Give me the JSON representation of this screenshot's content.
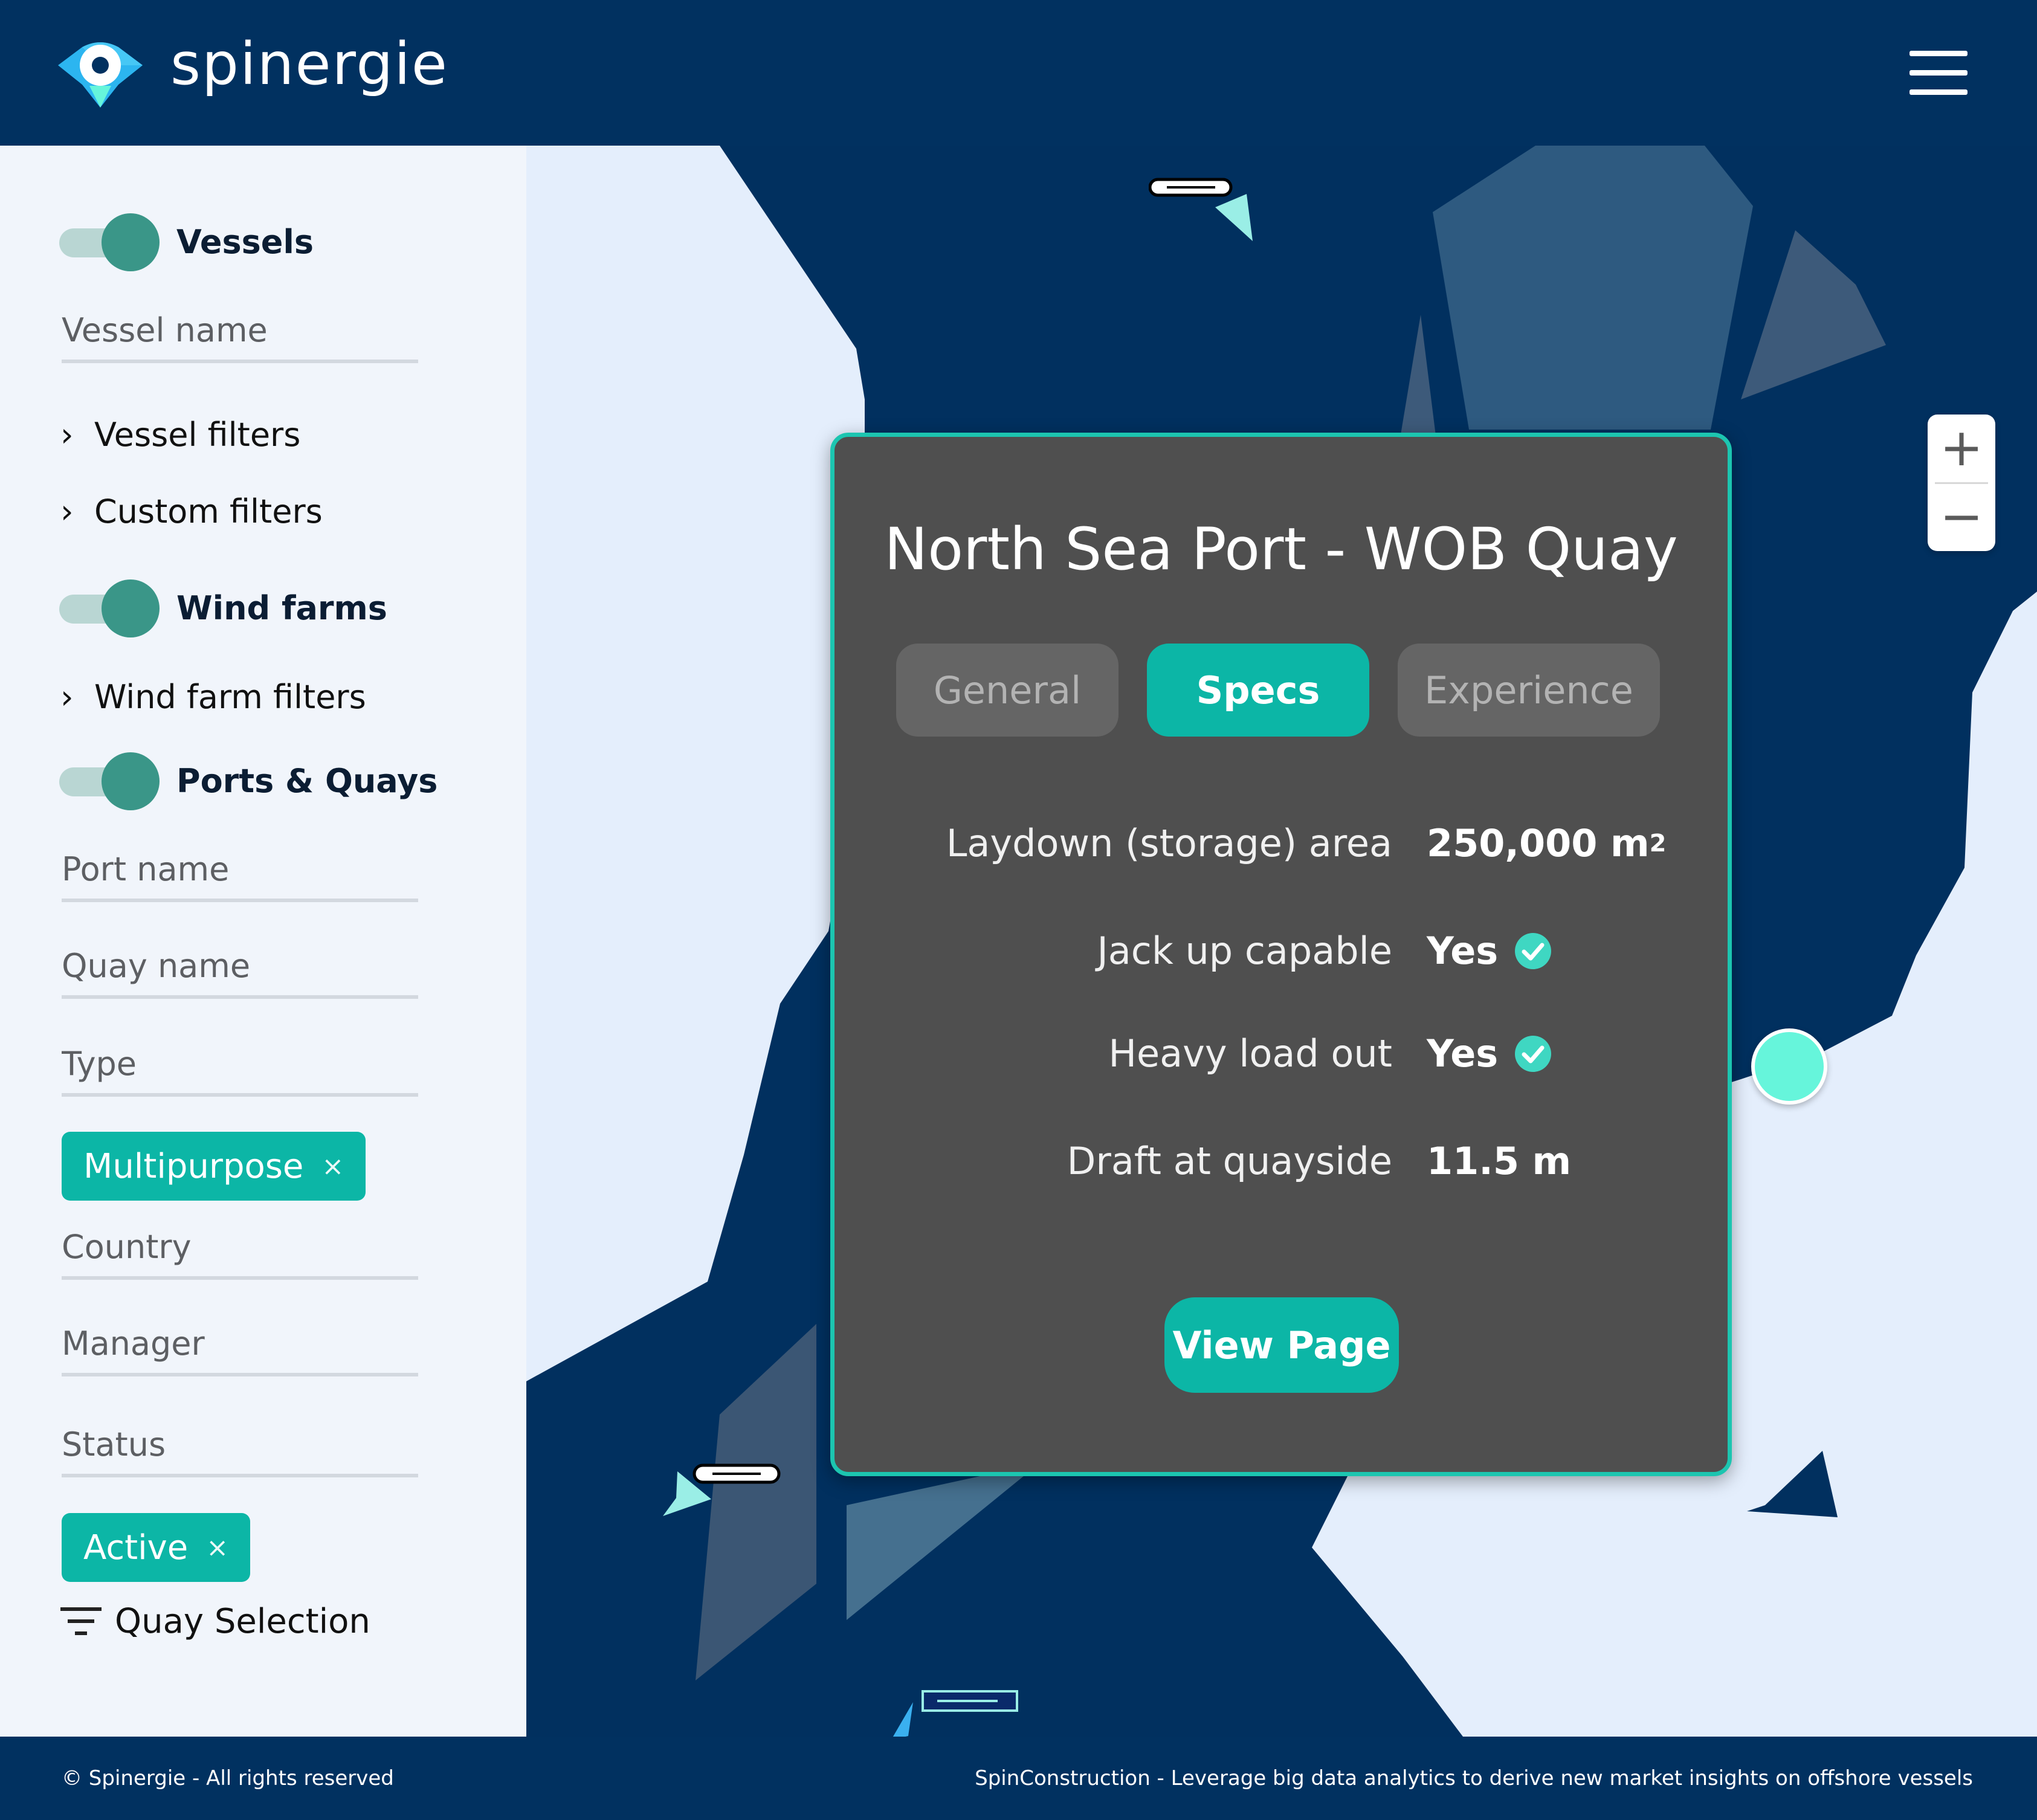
{
  "header": {
    "brand": "spinergie",
    "logo_icon": "location-pin-eye-icon",
    "menu_icon": "hamburger-icon"
  },
  "sidebar": {
    "vessels": {
      "toggle_label": "Vessels",
      "toggle_on": true,
      "name_placeholder": "Vessel name",
      "filters": [
        "Vessel filters",
        "Custom filters"
      ]
    },
    "wind_farms": {
      "toggle_label": "Wind farms",
      "toggle_on": true,
      "filters": [
        "Wind farm filters"
      ]
    },
    "ports": {
      "toggle_label": "Ports & Quays",
      "toggle_on": true,
      "port_name_placeholder": "Port name",
      "quay_name_placeholder": "Quay name",
      "type_placeholder": "Type",
      "type_chip": "Multipurpose",
      "country_placeholder": "Country",
      "manager_placeholder": "Manager",
      "status_placeholder": "Status",
      "status_chip": "Active",
      "chip_remove": "×",
      "quay_selection": "Quay Selection"
    }
  },
  "map": {
    "zoom_in": "+",
    "zoom_out": "−"
  },
  "popup": {
    "title": "North Sea Port - WOB Quay",
    "tabs": [
      {
        "label": "General",
        "active": false
      },
      {
        "label": "Specs",
        "active": true
      },
      {
        "label": "Experience",
        "active": false
      }
    ],
    "specs": [
      {
        "label": "Laydown (storage) area",
        "value": "250,000 m",
        "sup": "2",
        "check": false
      },
      {
        "label": "Jack up capable",
        "value": "Yes",
        "sup": "",
        "check": true
      },
      {
        "label": "Heavy load out",
        "value": "Yes",
        "sup": "",
        "check": true
      },
      {
        "label": "Draft at quayside",
        "value": "11.5 m",
        "sup": "",
        "check": false
      }
    ],
    "view_button": "View Page"
  },
  "footer": {
    "left": "© Spinergie - All rights reserved",
    "right": "SpinConstruction - Leverage big data analytics to derive new market insights on offshore vessels"
  },
  "colors": {
    "navy": "#013160",
    "teal": "#0cb6a6",
    "popup_bg": "#4f4f4f",
    "popup_border": "#1cc5b0",
    "marker": "#66f5db"
  }
}
